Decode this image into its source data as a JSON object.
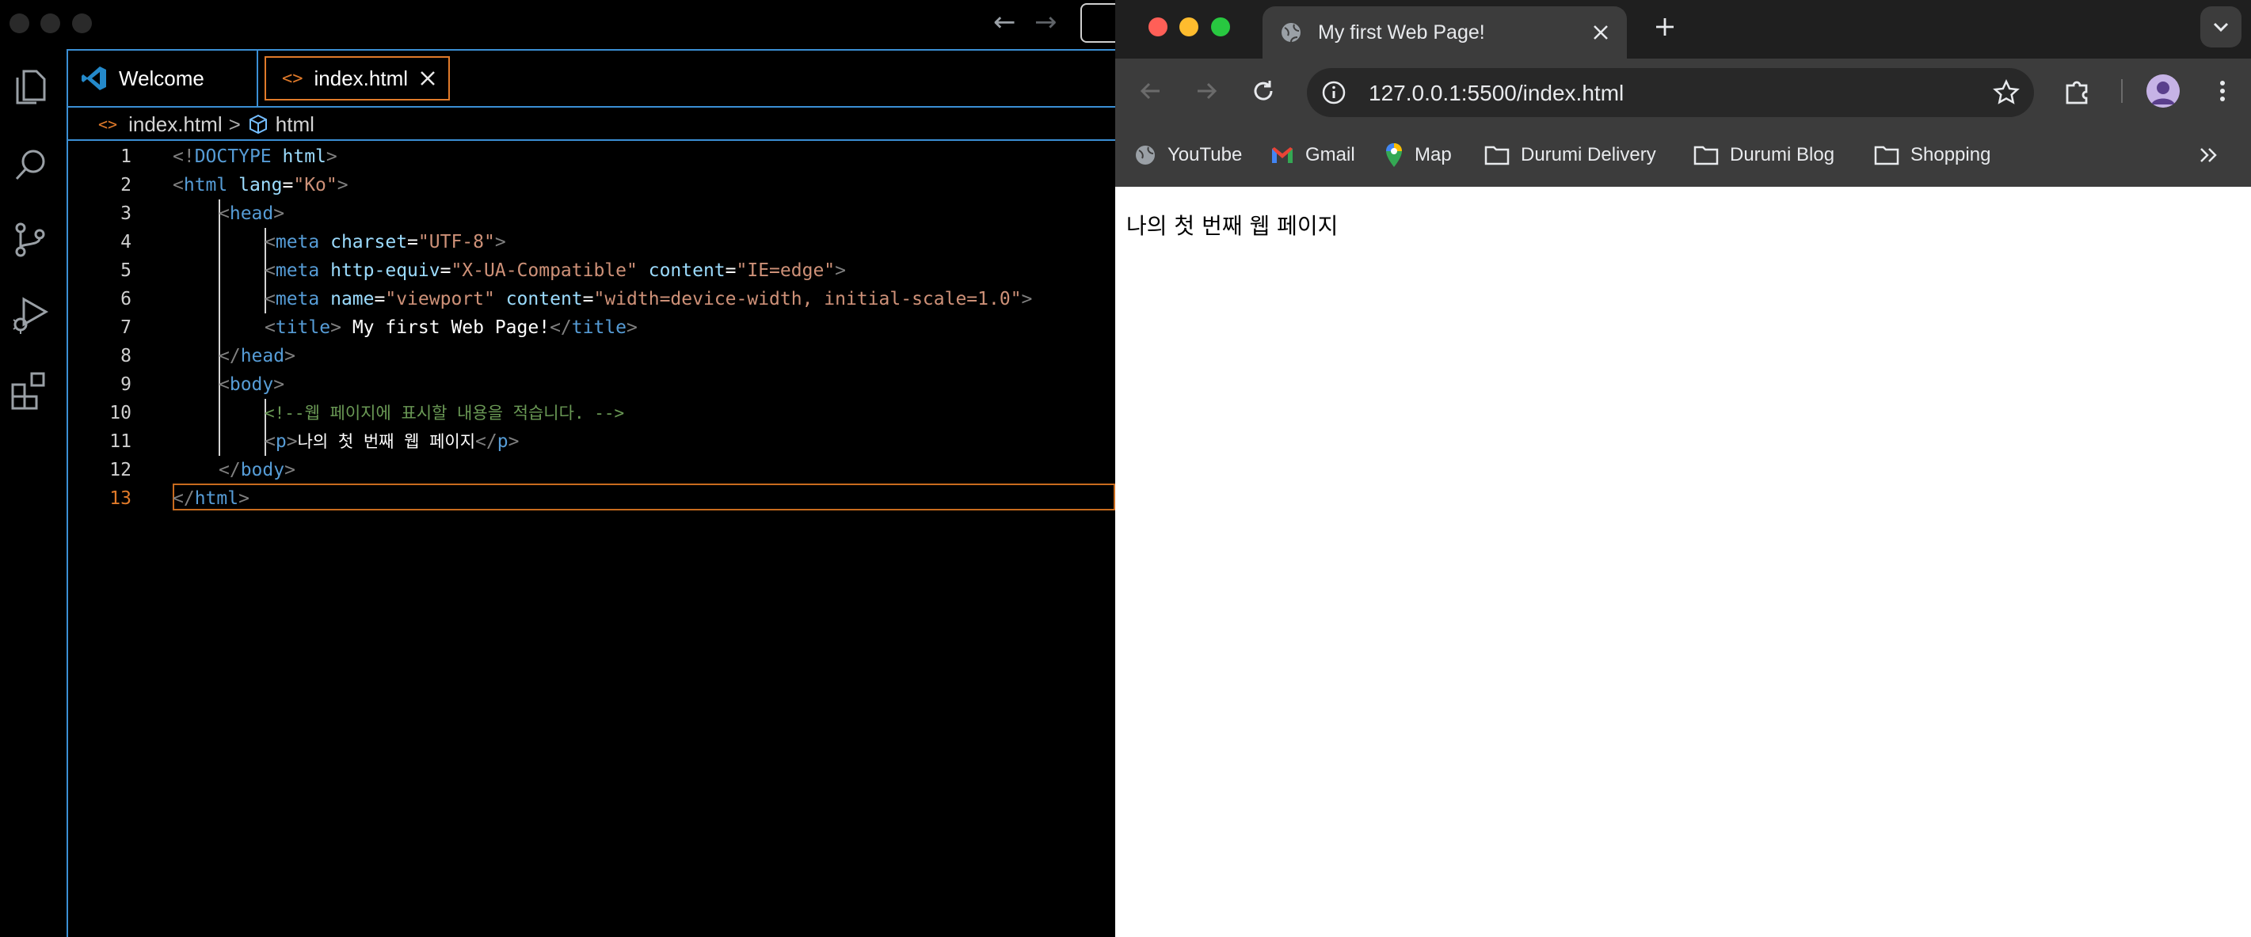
{
  "vscode": {
    "tabs": [
      {
        "label": "Welcome",
        "icon": "vscode-logo-icon"
      },
      {
        "label": "index.html",
        "icon": "html-file-icon",
        "active": true
      }
    ],
    "breadcrumb": {
      "file": "index.html",
      "separator": ">",
      "symbol": "html"
    },
    "active_line": 13,
    "line_numbers": [
      "1",
      "2",
      "3",
      "4",
      "5",
      "6",
      "7",
      "8",
      "9",
      "10",
      "11",
      "12",
      "13"
    ],
    "code": {
      "l1": {
        "open": "<!",
        "doctype": "DOCTYPE",
        "html": "html",
        "close": ">"
      },
      "l2": {
        "open": "<",
        "tag": "html",
        "attr": "lang",
        "eq": "=",
        "val": "\"Ko\"",
        "close": ">"
      },
      "l3": {
        "open": "<",
        "tag": "head",
        "close": ">"
      },
      "l4": {
        "open": "<",
        "tag": "meta",
        "attr": "charset",
        "eq": "=",
        "val": "\"UTF-8\"",
        "close": ">"
      },
      "l5": {
        "open": "<",
        "tag": "meta",
        "attr1": "http-equiv",
        "eq1": "=",
        "val1": "\"X-UA-Compatible\"",
        "attr2": "content",
        "eq2": "=",
        "val2": "\"IE=edge\"",
        "close": ">"
      },
      "l6": {
        "open": "<",
        "tag": "meta",
        "attr1": "name",
        "eq1": "=",
        "val1": "\"viewport\"",
        "attr2": "content",
        "eq2": "=",
        "val2": "\"width=device-width, initial-scale=1.0\"",
        "close": ">"
      },
      "l7": {
        "open": "<",
        "tag": "title",
        "close": ">",
        "text": " My first Web Page!",
        "end_open": "</",
        "end_tag": "title",
        "end_close": ">"
      },
      "l8": {
        "open": "</",
        "tag": "head",
        "close": ">"
      },
      "l9": {
        "open": "<",
        "tag": "body",
        "close": ">"
      },
      "l10": {
        "comment": "<!--웹 페이지에 표시할 내용을 적습니다. -->"
      },
      "l11": {
        "open": "<",
        "tag": "p",
        "close": ">",
        "text": "나의 첫 번째 웹 페이지",
        "end_open": "</",
        "end_tag": "p",
        "end_close": ">"
      },
      "l12": {
        "open": "</",
        "tag": "body",
        "close": ">"
      },
      "l13": {
        "open": "</",
        "tag": "html",
        "close": ">"
      }
    }
  },
  "chrome": {
    "tab_title": "My first Web Page!",
    "url": "127.0.0.1:5500/index.html",
    "bookmarks": [
      {
        "label": "YouTube",
        "icon": "globe-icon"
      },
      {
        "label": "Gmail",
        "icon": "gmail-icon"
      },
      {
        "label": "Map",
        "icon": "maps-pin-icon"
      },
      {
        "label": "Durumi Delivery",
        "icon": "folder-icon"
      },
      {
        "label": "Durumi Blog",
        "icon": "folder-icon"
      },
      {
        "label": "Shopping",
        "icon": "folder-icon"
      }
    ],
    "page_text": "나의 첫 번째 웹 페이지"
  },
  "colors": {
    "accent_blue": "#3b8fd4",
    "active_tab_border": "#e07a2a",
    "tag_blue": "#569cd6",
    "attr_lightblue": "#9cdcfe",
    "string_orange": "#ce9178",
    "comment_green": "#6a9955"
  }
}
